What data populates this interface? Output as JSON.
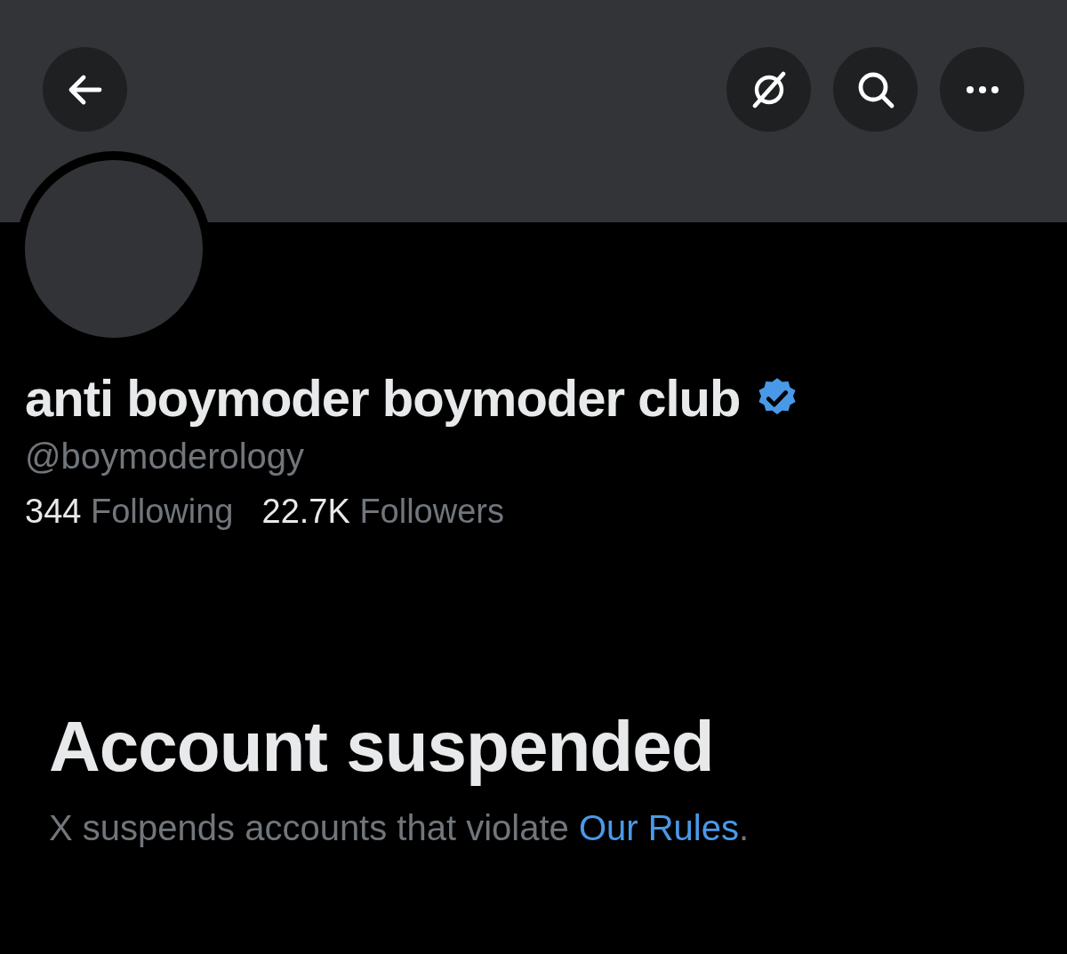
{
  "header": {
    "buttons": [
      {
        "kind": "back"
      },
      {
        "kind": "grok"
      },
      {
        "kind": "search"
      },
      {
        "kind": "more"
      }
    ]
  },
  "profile": {
    "name": "anti boymoder boymoder club",
    "verified": true,
    "handle": "@boymoderology",
    "stats": [
      {
        "count": "344",
        "label": "Following"
      },
      {
        "count": "22.7K",
        "label": "Followers"
      }
    ]
  },
  "notice": {
    "title": "Account suspended",
    "text_before": "X suspends accounts that violate ",
    "link": "Our Rules",
    "text_after": "."
  }
}
